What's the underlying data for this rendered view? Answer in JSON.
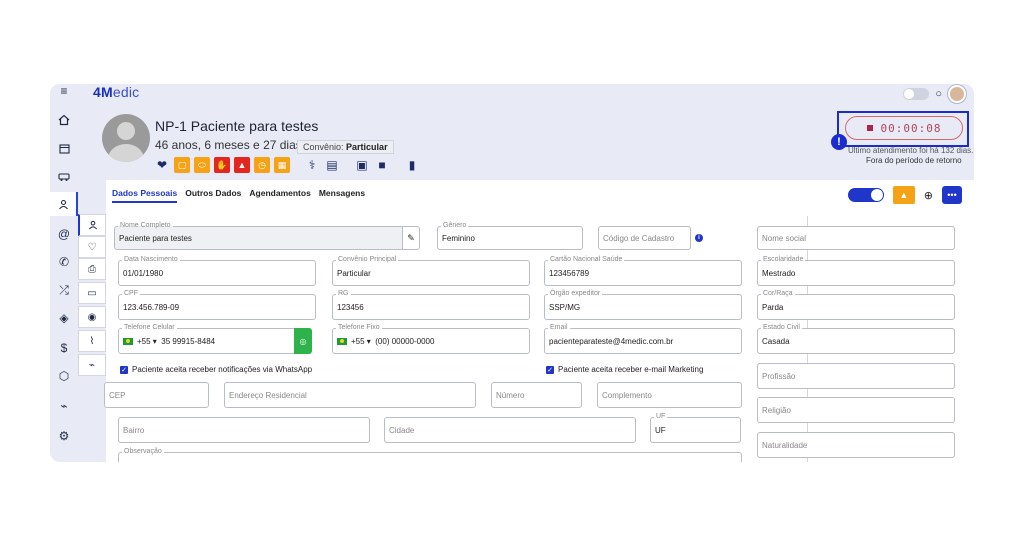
{
  "app": {
    "logo_main": "4M",
    "logo_rest": "edic"
  },
  "patient": {
    "name": "NP-1 Paciente para testes",
    "age": "46 anos, 6 meses e 27 dias",
    "convenio_label": "Convênio:",
    "convenio_value": "Particular"
  },
  "timer": {
    "value": "00:00:08",
    "note_last": "Último atendimento foi há 132 dias.",
    "note_return": "Fora do período de retorno",
    "alert_symbol": "!"
  },
  "tabs": [
    {
      "label": "Dados Pessoais",
      "active": true
    },
    {
      "label": "Outros Dados",
      "active": false
    },
    {
      "label": "Agendamentos",
      "active": false
    },
    {
      "label": "Mensagens",
      "active": false
    }
  ],
  "form": {
    "nome_completo": {
      "label": "Nome Completo",
      "value": "Paciente para testes"
    },
    "genero": {
      "label": "Gênero",
      "value": "Feminino"
    },
    "codigo_cadastro": {
      "placeholder": "Código de Cadastro"
    },
    "nome_social": {
      "placeholder": "Nome social"
    },
    "data_nascimento": {
      "label": "Data Nascimento",
      "value": "01/01/1980"
    },
    "convenio_principal": {
      "label": "Convênio Principal",
      "value": "Particular"
    },
    "cartao_sus": {
      "label": "Cartão Nacional Saúde",
      "value": "123456789"
    },
    "escolaridade": {
      "label": "Escolaridade",
      "value": "Mestrado"
    },
    "cpf": {
      "label": "CPF",
      "value": "123.456.789-09"
    },
    "rg": {
      "label": "RG",
      "value": "123456"
    },
    "orgao_expedidor": {
      "label": "Órgão expeditor",
      "value": "SSP/MG"
    },
    "cor_raca": {
      "label": "Cor/Raça",
      "value": "Parda"
    },
    "telefone_celular": {
      "label": "Telefone Celular",
      "ddi": "+55",
      "value": "35 99915-8484"
    },
    "telefone_fixo": {
      "label": "Telefone Fixo",
      "ddi": "+55",
      "value": "(00) 00000-0000"
    },
    "email": {
      "label": "Email",
      "value": "pacienteparateste@4medic.com.br"
    },
    "estado_civil": {
      "label": "Estado Civil",
      "value": "Casada"
    },
    "whatsapp_consent": "Paciente aceita receber notificações via WhatsApp",
    "email_consent": "Paciente aceita receber e-mail Marketing",
    "profissao": {
      "placeholder": "Profissão"
    },
    "cep": {
      "placeholder": "CEP"
    },
    "endereco": {
      "placeholder": "Endereço Residencial"
    },
    "numero": {
      "placeholder": "Número"
    },
    "complemento": {
      "placeholder": "Complemento"
    },
    "religiao": {
      "placeholder": "Religião"
    },
    "bairro": {
      "placeholder": "Bairro"
    },
    "cidade": {
      "placeholder": "Cidade"
    },
    "uf": {
      "label": "UF",
      "value": "UF"
    },
    "naturalidade": {
      "placeholder": "Naturalidade"
    },
    "observacao": {
      "label": "Observação"
    }
  },
  "colors": {
    "accent": "#1f36c8",
    "warning": "#f5a217",
    "danger": "#e3261e",
    "whatsapp": "#2db34a"
  }
}
